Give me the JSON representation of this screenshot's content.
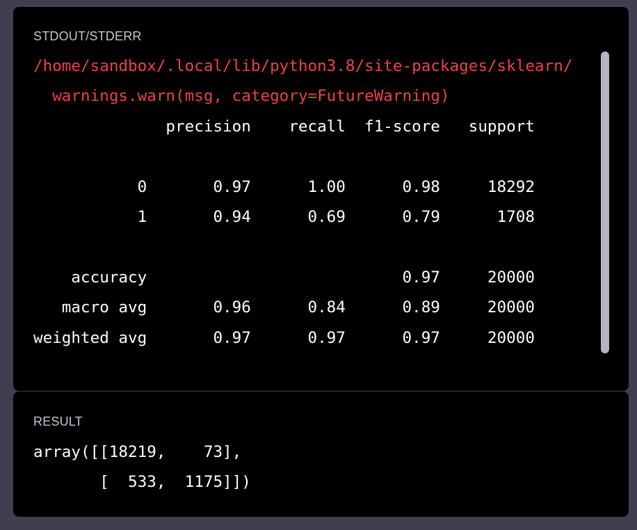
{
  "stdout": {
    "label": "STDOUT/STDERR",
    "lines": [
      {
        "text": "/home/sandbox/.local/lib/python3.8/site-packages/sklearn/",
        "kind": "warn"
      },
      {
        "text": "  warnings.warn(msg, category=FutureWarning)",
        "kind": "warn"
      },
      {
        "text": "              precision    recall  f1-score   support",
        "kind": "normal"
      },
      {
        "text": "",
        "kind": "normal"
      },
      {
        "text": "           0       0.97      1.00      0.98     18292",
        "kind": "normal"
      },
      {
        "text": "           1       0.94      0.69      0.79      1708",
        "kind": "normal"
      },
      {
        "text": "",
        "kind": "normal"
      },
      {
        "text": "    accuracy                           0.97     20000",
        "kind": "normal"
      },
      {
        "text": "   macro avg       0.96      0.84      0.89     20000",
        "kind": "normal"
      },
      {
        "text": "weighted avg       0.97      0.97      0.97     20000",
        "kind": "normal"
      }
    ]
  },
  "result": {
    "label": "RESULT",
    "lines": [
      "array([[18219,    73],",
      "       [  533,  1175]])"
    ]
  },
  "colors": {
    "page_background": "#3f3f4f",
    "panel_background": "#000000",
    "label_text": "#c5c5d2",
    "output_text": "#ffffff",
    "warning_text": "#ef4146",
    "scrollbar": "#b4b4c0"
  }
}
